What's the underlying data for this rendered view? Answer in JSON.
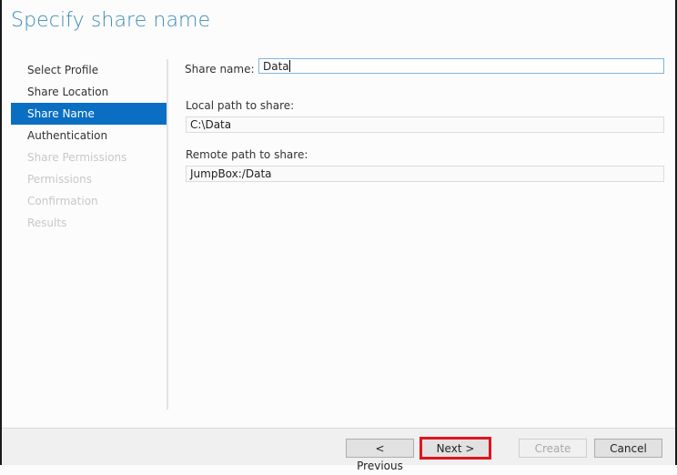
{
  "page": {
    "title": "Specify share name"
  },
  "nav": {
    "items": [
      {
        "label": "Select Profile",
        "state": "done"
      },
      {
        "label": "Share Location",
        "state": "done"
      },
      {
        "label": "Share Name",
        "state": "active"
      },
      {
        "label": "Authentication",
        "state": "done"
      },
      {
        "label": "Share Permissions",
        "state": "disabled"
      },
      {
        "label": "Permissions",
        "state": "disabled"
      },
      {
        "label": "Confirmation",
        "state": "disabled"
      },
      {
        "label": "Results",
        "state": "disabled"
      }
    ]
  },
  "form": {
    "share_name_label": "Share name:",
    "share_name_value": "Data",
    "local_path_label": "Local path to share:",
    "local_path_value": "C:\\Data",
    "remote_path_label": "Remote path to share:",
    "remote_path_value": "JumpBox:/Data"
  },
  "footer": {
    "previous_label": "< Previous",
    "next_label": "Next >",
    "create_label": "Create",
    "cancel_label": "Cancel"
  },
  "colors": {
    "accent": "#0a6fc2",
    "title": "#3b8cb5",
    "highlight": "#e0141e"
  }
}
